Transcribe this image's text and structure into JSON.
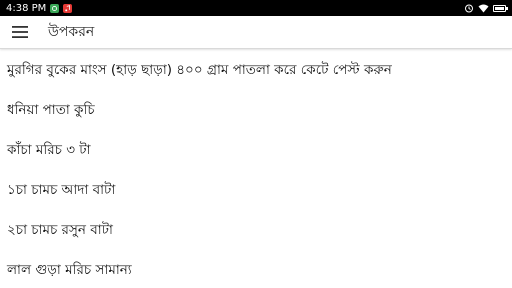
{
  "status_bar": {
    "time": "4:38 PM",
    "notification_icons": [
      "whatsapp-icon",
      "music-icon"
    ],
    "right_icons": [
      "alarm-icon",
      "wifi-icon",
      "battery-icon"
    ],
    "battery_level": 0.8
  },
  "app_bar": {
    "menu_icon": "hamburger-menu-icon",
    "title": "উপকরন"
  },
  "ingredients": [
    "মুরগির বুকের মাংস (হাড় ছাড়া) ৪০০ গ্রাম পাতলা করে কেটে পেস্ট করুন",
    "ধনিয়া পাতা কুচি",
    "কাঁচা মরিচ ৩ টা",
    "১চা চামচ আদা বাটা",
    "২চা চামচ রসুন বাটা",
    "লাল গুড়া মরিচ সামান্য"
  ],
  "colors": {
    "status_bar_bg": "#000000",
    "app_bar_bg": "#ffffff",
    "text": "#111111"
  }
}
